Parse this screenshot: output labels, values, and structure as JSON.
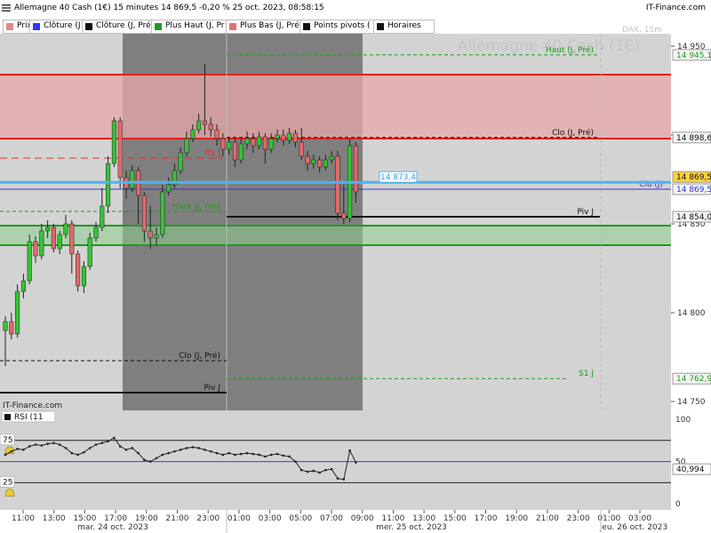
{
  "header": {
    "title": "Allemagne 40 Cash (1€) 15 minutes 14 869,5 -0,20 % 25 oct. 2023, 08:58:15",
    "brand": "IT-Finance.com"
  },
  "legend_items": [
    {
      "label": "Prix",
      "color": "#e38a8a"
    },
    {
      "label": "Clôture (J",
      "color": "#3333ff"
    },
    {
      "label": "Clôture (J, Pré",
      "color": "#111111"
    },
    {
      "label": "Plus Haut (J, Pr",
      "color": "#1f9a1f"
    },
    {
      "label": "Plus Bas (J, Pré",
      "color": "#e07070"
    },
    {
      "label": "Points pivots (",
      "color": "#111111"
    },
    {
      "label": "Horaires",
      "color": "#111111"
    }
  ],
  "watermark": {
    "text": "Allemagne 40 Cash (1€)",
    "sub": "DAX, 15m"
  },
  "chart_data": {
    "type": "candlestick",
    "price_axis": {
      "ticks": [
        "14 950",
        "14 900",
        "14 850",
        "14 800",
        "14 750"
      ]
    },
    "time_axis": {
      "ticks": [
        "11:00",
        "13:00",
        "15:00",
        "17:00",
        "19:00",
        "21:00",
        "23:00",
        "01:00",
        "03:00",
        "05:00",
        "07:00",
        "09:00",
        "11:00",
        "13:00",
        "15:00",
        "17:00",
        "19:00",
        "21:00",
        "23:00",
        "01:00",
        "03:00"
      ],
      "dates": [
        "mar. 24 oct. 2023",
        "mer. 25 oct. 2023",
        "jeu. 26 oct. 2023"
      ]
    },
    "levels": [
      {
        "label": "Haut (J, Pré)",
        "value": 14945.1,
        "tag": "14 945,1",
        "style": "dashed",
        "color": "#1f9a1f"
      },
      {
        "label": "Clo (J, Pré)",
        "value": 14898.6,
        "tag": "14 898,6",
        "style": "dashed",
        "color": "#111111"
      },
      {
        "label": "R1 J",
        "value": 14887,
        "style": "dashed",
        "color": "#e03030"
      },
      {
        "label": "Clo (J)",
        "value": 14869.5,
        "tag": "14 869,5",
        "style": "solid",
        "color": "#3333cc"
      },
      {
        "label": "Haut (J, Pré)",
        "value": 14857,
        "style": "dashed",
        "color": "#1f9a1f"
      },
      {
        "label": "Piv J",
        "value": 14854.0,
        "tag": "14 854,0",
        "style": "solid",
        "color": "#111111"
      },
      {
        "label": "Clo (J, Pré)",
        "value": 14773,
        "style": "dashed",
        "color": "#111111"
      },
      {
        "label": "S1 J",
        "value": 14762.9,
        "tag": "14 762,9",
        "style": "dashed",
        "color": "#1f9a1f"
      },
      {
        "label": "Piv J",
        "value": 14755,
        "style": "solid",
        "color": "#111111"
      }
    ],
    "current_price": {
      "value": 14873.4,
      "label": "14 873,4",
      "tag": "14 869,5"
    },
    "bands": [
      {
        "name": "resistance",
        "from": 14898,
        "to": 14934,
        "color": "#e8a8a8"
      },
      {
        "name": "support",
        "from": 14838,
        "to": 14849,
        "color": "#1f9a1f"
      }
    ],
    "candles": [
      [
        14790,
        14795,
        14770,
        14798
      ],
      [
        14795,
        14788,
        14785,
        14800
      ],
      [
        14788,
        14812,
        14786,
        14816
      ],
      [
        14812,
        14818,
        14808,
        14822
      ],
      [
        14818,
        14840,
        14816,
        14844
      ],
      [
        14840,
        14832,
        14828,
        14843
      ],
      [
        14832,
        14846,
        14830,
        14850
      ],
      [
        14846,
        14848,
        14842,
        14852
      ],
      [
        14848,
        14836,
        14834,
        14850
      ],
      [
        14836,
        14844,
        14833,
        14846
      ],
      [
        14844,
        14850,
        14842,
        14855
      ],
      [
        14850,
        14833,
        14822,
        14852
      ],
      [
        14833,
        14815,
        14812,
        14835
      ],
      [
        14815,
        14826,
        14811,
        14829
      ],
      [
        14826,
        14842,
        14824,
        14845
      ],
      [
        14842,
        14848,
        14840,
        14851
      ],
      [
        14848,
        14860,
        14846,
        14870
      ],
      [
        14860,
        14884,
        14856,
        14888
      ],
      [
        14884,
        14908,
        14882,
        14910
      ],
      [
        14908,
        14876,
        14870,
        14910
      ],
      [
        14876,
        14870,
        14864,
        14880
      ],
      [
        14870,
        14880,
        14868,
        14883
      ],
      [
        14880,
        14866,
        14850,
        14882
      ],
      [
        14866,
        14846,
        14840,
        14868
      ],
      [
        14846,
        14842,
        14836,
        14860
      ],
      [
        14842,
        14844,
        14838,
        14848
      ],
      [
        14844,
        14868,
        14842,
        14872
      ],
      [
        14868,
        14872,
        14866,
        14876
      ],
      [
        14872,
        14880,
        14870,
        14884
      ],
      [
        14880,
        14890,
        14878,
        14893
      ],
      [
        14890,
        14898,
        14888,
        14902
      ],
      [
        14898,
        14903,
        14896,
        14906
      ],
      [
        14903,
        14908,
        14901,
        14912
      ],
      [
        14908,
        14906,
        14900,
        14940
      ],
      [
        14906,
        14903,
        14899,
        14910
      ],
      [
        14903,
        14898,
        14894,
        14906
      ],
      [
        14898,
        14892,
        14888,
        14901
      ],
      [
        14892,
        14896,
        14889,
        14899
      ],
      [
        14896,
        14886,
        14882,
        14898
      ],
      [
        14886,
        14895,
        14884,
        14898
      ],
      [
        14895,
        14898,
        14892,
        14902
      ],
      [
        14898,
        14894,
        14890,
        14901
      ],
      [
        14894,
        14899,
        14892,
        14902
      ],
      [
        14899,
        14892,
        14884,
        14901
      ],
      [
        14892,
        14898,
        14890,
        14901
      ],
      [
        14898,
        14900,
        14896,
        14903
      ],
      [
        14900,
        14897,
        14894,
        14903
      ],
      [
        14897,
        14901,
        14895,
        14904
      ],
      [
        14901,
        14896,
        14893,
        14903
      ],
      [
        14896,
        14888,
        14886,
        14904
      ],
      [
        14888,
        14884,
        14880,
        14891
      ],
      [
        14884,
        14886,
        14881,
        14889
      ],
      [
        14886,
        14882,
        14879,
        14888
      ],
      [
        14882,
        14886,
        14880,
        14889
      ],
      [
        14886,
        14888,
        14884,
        14891
      ],
      [
        14888,
        14856,
        14852,
        14891
      ],
      [
        14856,
        14853,
        14850,
        14872
      ],
      [
        14853,
        14894,
        14851,
        14898
      ],
      [
        14894,
        14868,
        14862,
        14896
      ]
    ],
    "rsi": {
      "label": "RSI (11",
      "levels": [
        75,
        25
      ],
      "axis_ticks": [
        "100",
        "50",
        "0"
      ],
      "value_tag": "40,994",
      "values": [
        58,
        62,
        65,
        64,
        68,
        70,
        69,
        71,
        72,
        70,
        66,
        60,
        58,
        61,
        66,
        70,
        72,
        74,
        78,
        68,
        64,
        66,
        60,
        52,
        50,
        54,
        58,
        60,
        62,
        64,
        66,
        67,
        66,
        64,
        62,
        60,
        58,
        60,
        58,
        59,
        60,
        59,
        58,
        56,
        58,
        59,
        57,
        56,
        50,
        40,
        38,
        39,
        37,
        40,
        41,
        30,
        29,
        63,
        49
      ]
    }
  }
}
